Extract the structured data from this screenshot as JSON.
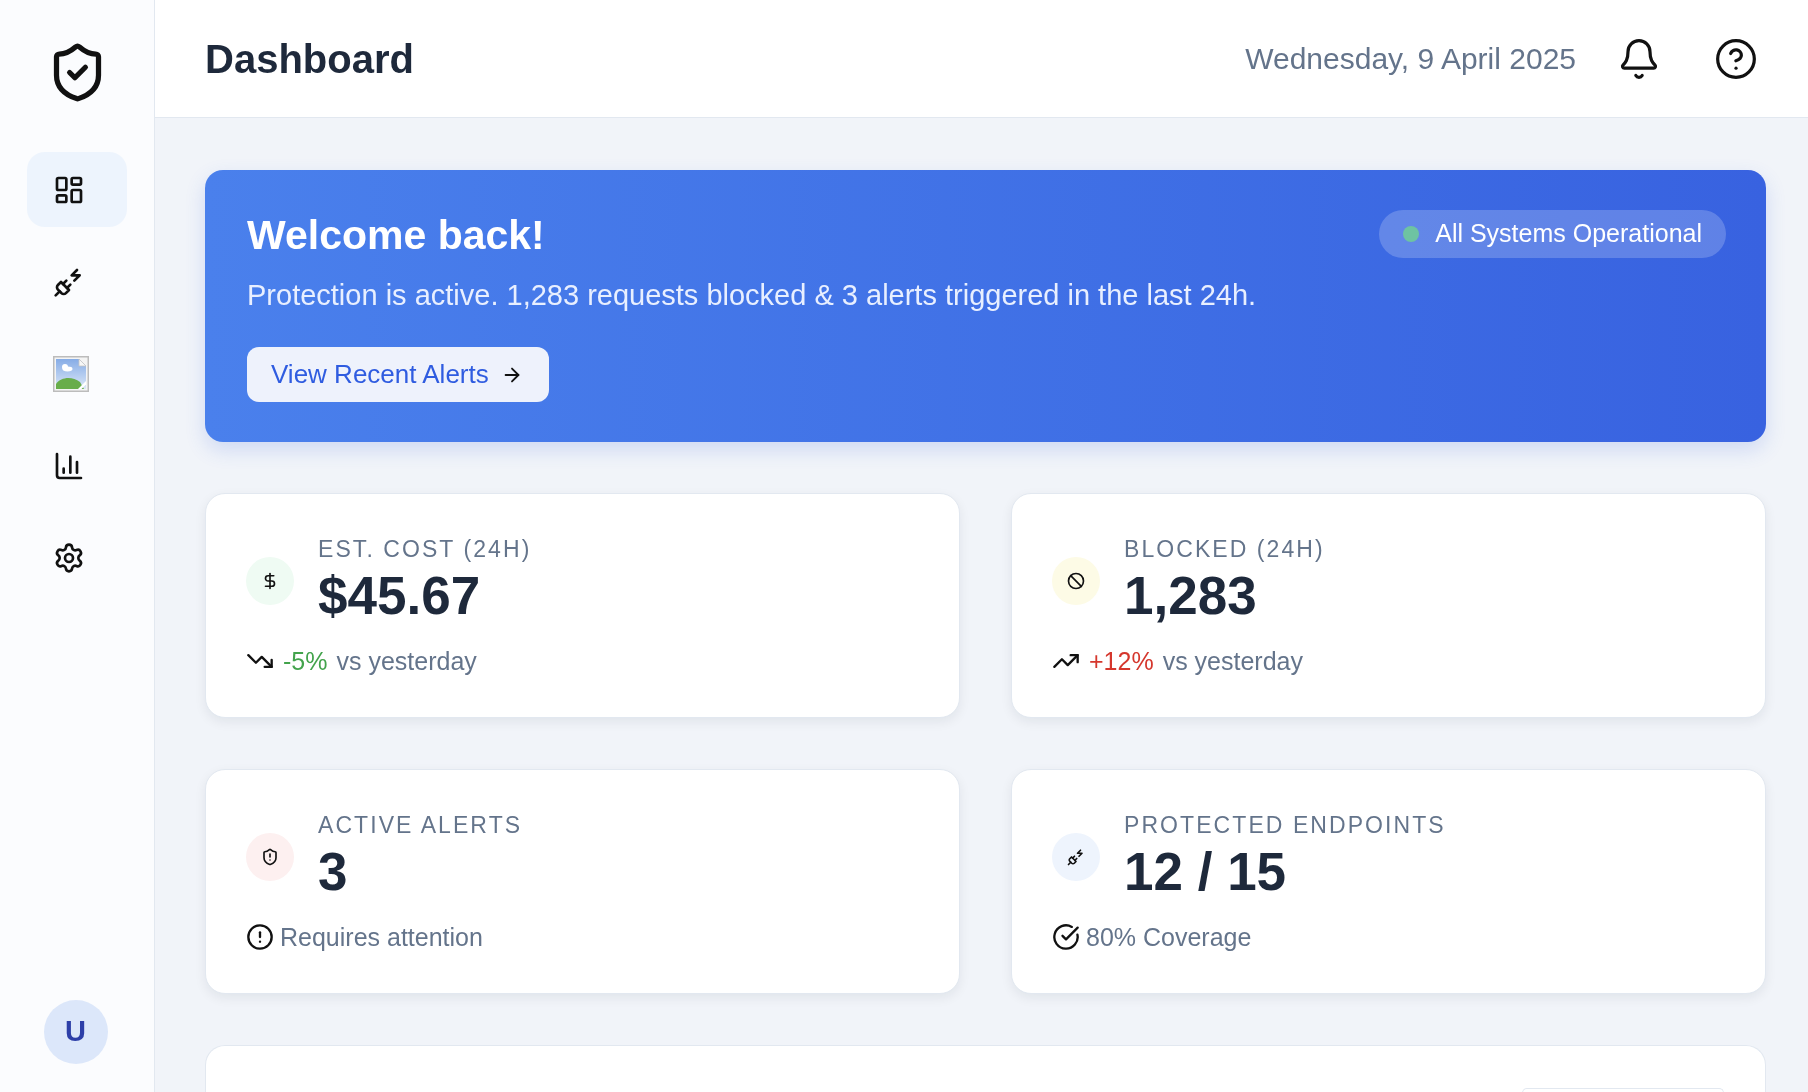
{
  "sidebar": {
    "nav_items": [
      {
        "selected": true
      },
      {
        "selected": false
      },
      {
        "selected": false
      },
      {
        "selected": false
      },
      {
        "selected": false
      }
    ],
    "avatar": {
      "initial": "U"
    }
  },
  "header": {
    "title": "Dashboard",
    "date": "Wednesday, 9 April 2025"
  },
  "banner": {
    "title": "Welcome back!",
    "message": "Protection is active. 1,283 requests blocked & 3 alerts triggered in the last 24h.",
    "button": "View Recent Alerts",
    "status": {
      "label": "All Systems Operational"
    }
  },
  "stats": [
    {
      "label": "EST. COST (24H)",
      "value": "$45.67",
      "color": "#effbf3",
      "footer": {
        "kind": "change",
        "increase": false,
        "change": "-5%",
        "text": "vs yesterday"
      }
    },
    {
      "label": "BLOCKED (24H)",
      "value": "1,283",
      "color": "#fdfbe6",
      "footer": {
        "kind": "change",
        "increase": true,
        "change": "+12%",
        "text": "vs yesterday"
      }
    },
    {
      "label": "ACTIVE ALERTS",
      "value": "3",
      "color": "#fdf0f0",
      "footer": {
        "kind": "alert",
        "text": "Requires attention"
      }
    },
    {
      "label": "PROTECTED ENDPOINTS",
      "value": "12 / 15",
      "color": "#eef4fd",
      "footer": {
        "kind": "ok",
        "text": "80% Coverage"
      }
    }
  ]
}
